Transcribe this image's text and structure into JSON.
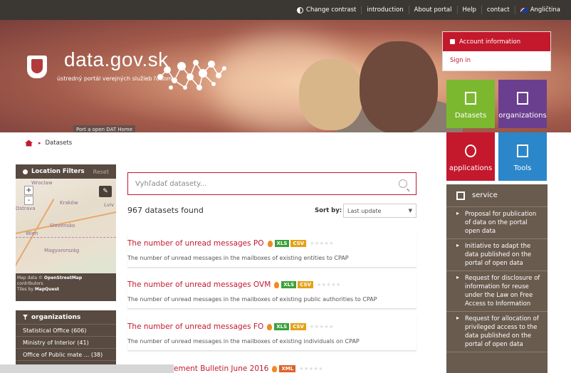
{
  "topbar": {
    "contrast": "Change contrast",
    "introduction": "introduction",
    "about": "About portal",
    "help": "Help",
    "contact": "contact",
    "language": "Angličtina"
  },
  "header": {
    "title": "data.gov.sk",
    "subtitle": "ústredný portál verejných služieb ľuďom",
    "home_badge": "Port a open DAT Home"
  },
  "account": {
    "title": "Account information",
    "sign_in": "Sign in"
  },
  "tiles": {
    "datasets": "Datasets",
    "organizations": "organizations",
    "applications": "applications",
    "tools": "Tools"
  },
  "service": {
    "title": "service",
    "items": [
      "Proposal for publication of data on the portal open data",
      "Initiative to adapt the data published on the portal of open data",
      "Request for disclosure of information for reuse under the Law on Free Access to Information",
      "Request for allocation of privileged access to the data published on the portal of open data"
    ]
  },
  "breadcrumb": {
    "current": "Datasets"
  },
  "location_filters": {
    "title": "Location Filters",
    "reset": "Reset",
    "map_labels": [
      "Wroclaw",
      "Kraków",
      "Ostrava",
      "Slovensko",
      "Wien",
      "Magyarország",
      "Lviv"
    ],
    "credit_line1": "Map data ©",
    "credit_osm": "OpenStreetMap",
    "credit_line2": "contributors",
    "credit_line3": "Tiles by",
    "credit_mq": "MapQuest"
  },
  "organizations": {
    "title": "organizations",
    "rows": [
      "Statistical Office (606)",
      "Ministry of Interior (41)",
      "Office of Public mate ... (38)"
    ]
  },
  "search": {
    "placeholder": "Vyhľadať datasety..."
  },
  "results_summary": {
    "count": "967 datasets found",
    "sort_label": "Sort by:",
    "sort_value": "Last update"
  },
  "results": [
    {
      "title": "The number of unread messages PO",
      "formats": [
        "XLS",
        "CSV"
      ],
      "description": "The number of unread messages in the mailboxes of existing entities to CPAP"
    },
    {
      "title": "The number of unread messages OVM",
      "formats": [
        "XLS",
        "CSV"
      ],
      "description": "The number of unread messages in the mailboxes of existing public authorities to CPAP"
    },
    {
      "title": "The number of unread messages FO",
      "formats": [
        "XLS",
        "CSV"
      ],
      "description": "The number of unread messages in the mailboxes of existing individuals on CPAP"
    },
    {
      "title": "ement Bulletin June 2016",
      "formats": [
        "XML"
      ],
      "description": ""
    }
  ],
  "colors": {
    "accent_red": "#c4182d",
    "datasets_green": "#7cb82f",
    "organizations_purple": "#6b3f8f",
    "tools_blue": "#2b87c9",
    "sidebar_brown": "#584a40"
  }
}
